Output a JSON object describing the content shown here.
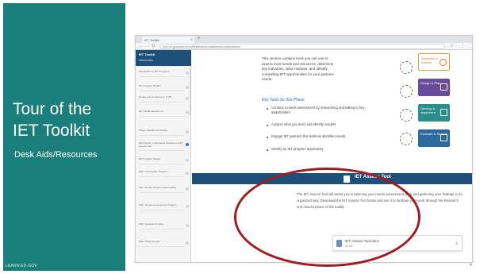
{
  "slide": {
    "title_line1": "Tour of the",
    "title_line2": "IET Toolkit",
    "subtitle": "Desk Aids/Resources",
    "footer": "LEARN.ED.GOV",
    "slide_number": "4",
    "colors": {
      "panel": "#1a7f7a",
      "annotation": "#9e1c23",
      "band": "#1d4f7a"
    }
  },
  "browser": {
    "tab_title": "IET Toolkit",
    "url": "lincs.ed.gov/state-resources/federal-initiatives/iet-toolkit/assess"
  },
  "sidebar": {
    "title": "IET Toolkit",
    "subtitle": "Introduction",
    "items": [
      "Introduction to IET Programs",
      "IET Program Models",
      "Quality and Components of IET",
      "IET Needs Assessment",
      "Phase: Identify and Assess",
      "IET Assess: Local Needs Assessment IET Assess Tool",
      "IET Program Design",
      "Plan: Develop IET Program",
      "Plan: Identify Partners and Funding",
      "Plan: Sustain and Improve Program",
      "Plan: Evaluate Program",
      "Plan: Share Results"
    ]
  },
  "main": {
    "intro": [
      "This section contains tools you can use to",
      "assess local needs and resources, determine",
      "key industries, labor markets, and identify",
      "compelling IET opportunities for your partners",
      "needs."
    ],
    "key_tools_heading": "Key Tools for this Phase",
    "bullets": [
      "Conduct a needs assessment by researching and talking to key stakeholders",
      "Analyze what you learn and identify insights",
      "Engage IET partners that address identified needs",
      "Identify an IET program opportunity"
    ],
    "flow": [
      {
        "label": "Research & Assess",
        "color": "#ffffff",
        "text_color": "#c0861c",
        "border": "#d9a234"
      },
      {
        "label": "Design & Plan",
        "color": "#6a4c9c"
      },
      {
        "label": "Develop & Implement",
        "color": "#2a8f8c"
      },
      {
        "label": "Evaluate & Sustain",
        "color": "#2c6aa0"
      }
    ],
    "section_title": "IET Assess Tool",
    "assess_text": "The IET Assess Tool will assist you in planning your needs assessment work and gathering your findings in an organized way. Download the IET Assess Tool below and use it to facilitate your work through the Research and Assess phase of the toolkit.",
    "download": {
      "name": "IET Assess Tool.docx",
      "size": "42 KB"
    }
  }
}
